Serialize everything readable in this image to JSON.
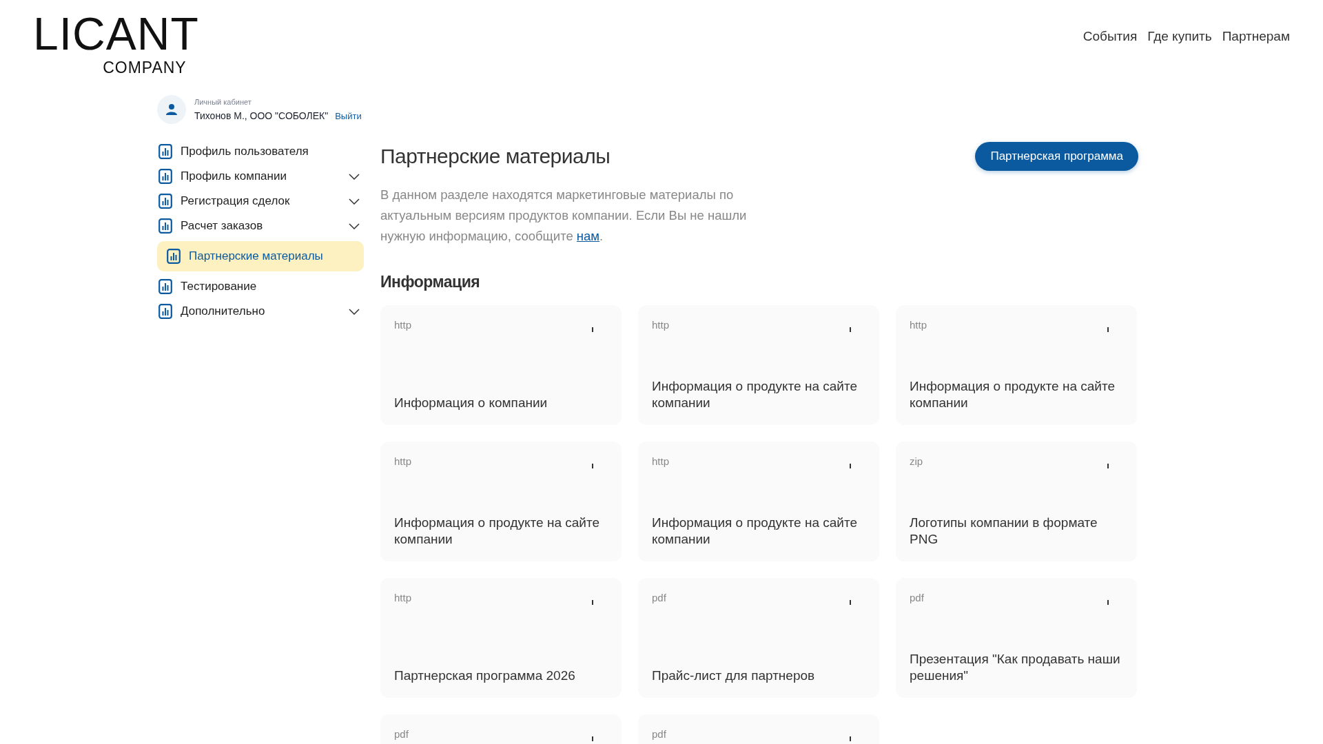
{
  "logo": {
    "name": "LICANT",
    "subtitle": "COMPANY"
  },
  "nav": [
    "События",
    "Где купить",
    "Партнерам"
  ],
  "account": {
    "caption": "Личный кабинет",
    "user": "Тихонов М., ООО \"СОБОЛЕК\"",
    "logout": "Выйти"
  },
  "sidebar": {
    "items": [
      {
        "label": "Профиль пользователя",
        "selected": false,
        "expandable": false
      },
      {
        "label": "Профиль компании",
        "selected": false,
        "expandable": true
      },
      {
        "label": "Регистрация сделок",
        "selected": false,
        "expandable": true
      },
      {
        "label": "Расчет заказов",
        "selected": false,
        "expandable": true
      },
      {
        "label": "Партнерские материалы",
        "selected": true,
        "expandable": false
      },
      {
        "label": "Тестирование",
        "selected": false,
        "expandable": false
      },
      {
        "label": "Дополнительно",
        "selected": false,
        "expandable": true
      }
    ]
  },
  "page": {
    "title": "Партнерские материалы",
    "action_button": "Партнерская программа",
    "description_before": "В данном разделе находятся маркетинговые материалы по актуальным версиям продуктов компании. Если Вы не нашли нужную информацию, сообщите ",
    "description_link": "нам",
    "description_after": "."
  },
  "section": {
    "title": "Информация",
    "cards": [
      {
        "type": "http",
        "title": "Информация о компании"
      },
      {
        "type": "http",
        "title": "Информация о продукте на сайте компании"
      },
      {
        "type": "http",
        "title": "Информация о продукте на сайте компании"
      },
      {
        "type": "http",
        "title": "Информация о продукте на сайте компании"
      },
      {
        "type": "http",
        "title": "Информация о продукте на сайте компании"
      },
      {
        "type": "zip",
        "title": "Логотипы компании в формате PNG"
      },
      {
        "type": "http",
        "title": "Партнерская программа 2026"
      },
      {
        "type": "pdf",
        "title": "Прайс-лист для партнеров"
      },
      {
        "type": "pdf",
        "title": "Презентация \"Как продавать наши решения\""
      },
      {
        "type": "pdf"
      },
      {
        "type": "pdf"
      }
    ]
  }
}
